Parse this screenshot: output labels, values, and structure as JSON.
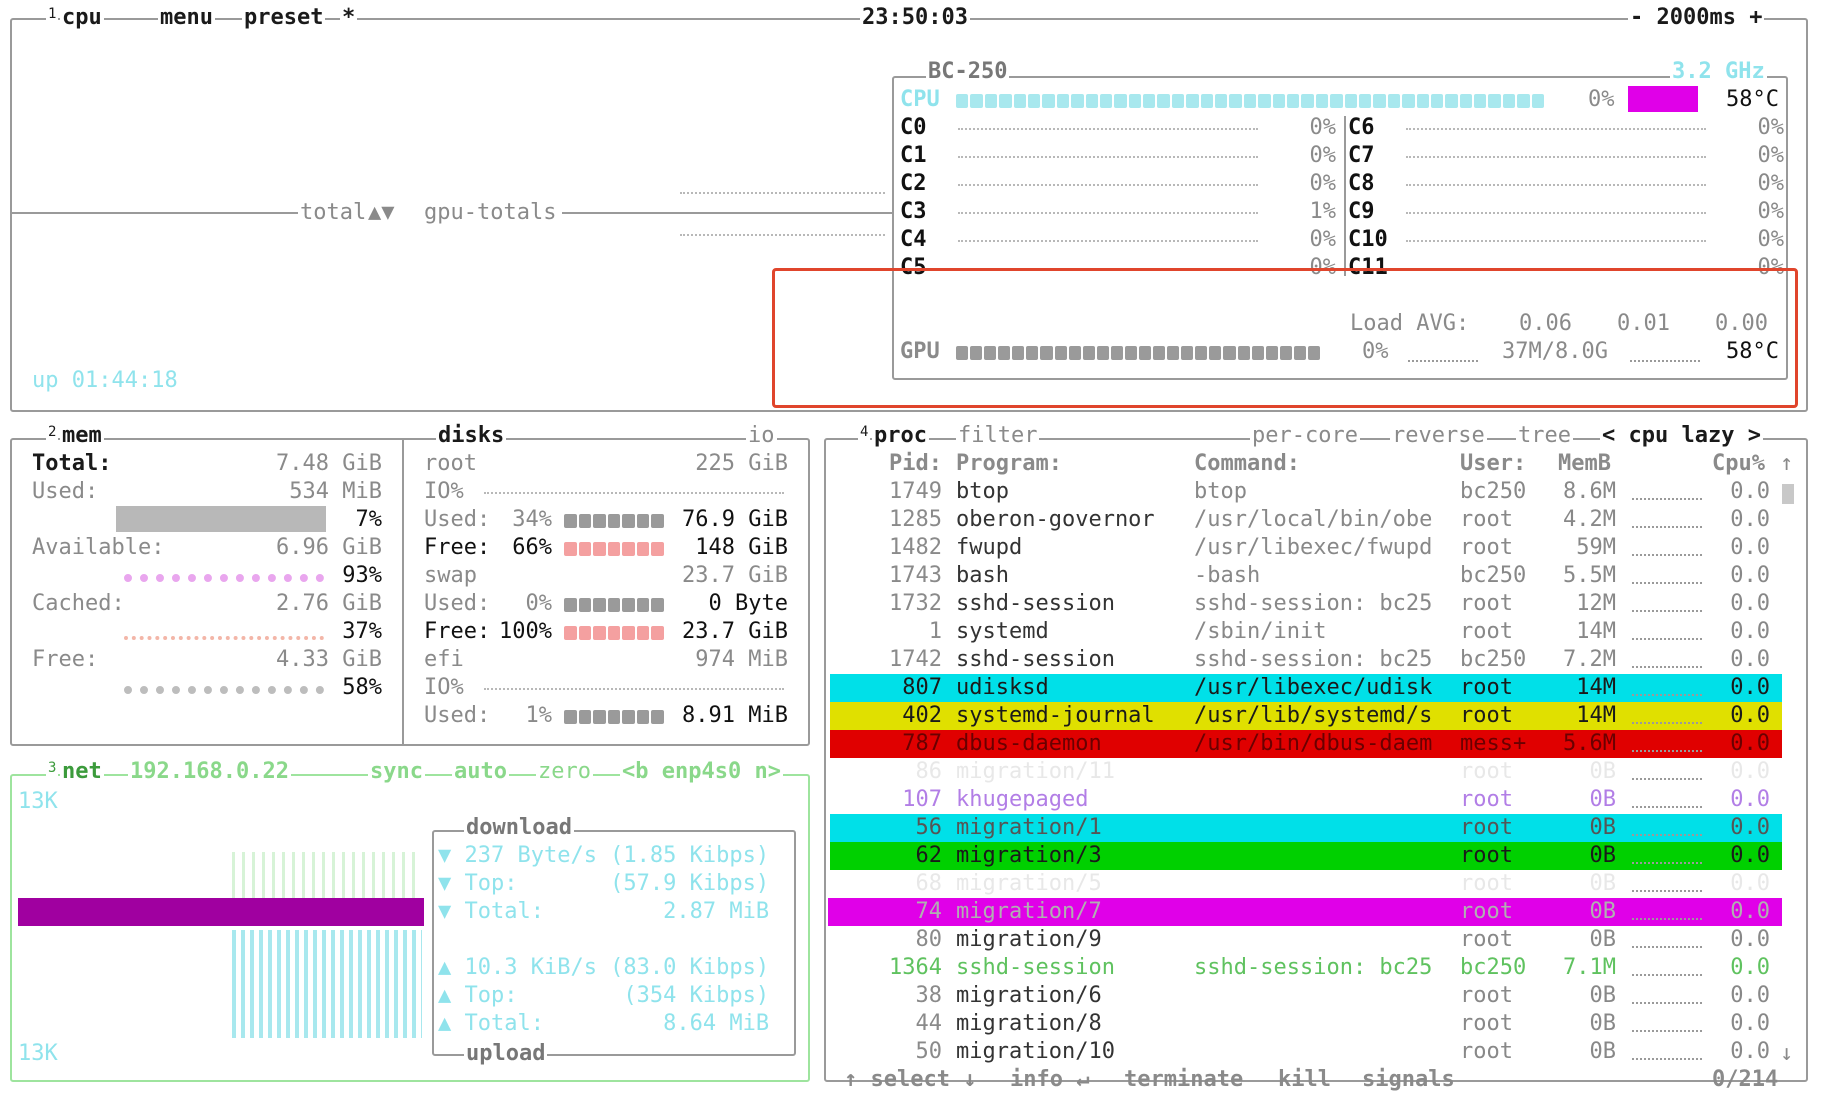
{
  "cpu_box": {
    "num": "1",
    "title": "cpu",
    "menu": "menu",
    "preset": "preset",
    "star": "*",
    "clock": "23:50:03",
    "interval": "- 2000ms +",
    "uptime": "up 01:44:18",
    "graph_label": "total",
    "graph_arrows": "▲▼",
    "graph_label2": "gpu-totals",
    "model": "BC-250",
    "freq": "3.2 GHz",
    "cpu_label": "CPU",
    "cpu_pct": "0%",
    "cpu_temp": "58°C",
    "cpu_pct_value": 0,
    "cores": [
      {
        "name": "C0",
        "pct": "0%"
      },
      {
        "name": "C1",
        "pct": "0%"
      },
      {
        "name": "C2",
        "pct": "0%"
      },
      {
        "name": "C3",
        "pct": "1%"
      },
      {
        "name": "C4",
        "pct": "0%"
      },
      {
        "name": "C5",
        "pct": "0%"
      },
      {
        "name": "C6",
        "pct": "0%"
      },
      {
        "name": "C7",
        "pct": "0%"
      },
      {
        "name": "C8",
        "pct": "0%"
      },
      {
        "name": "C9",
        "pct": "0%"
      },
      {
        "name": "C10",
        "pct": "0%"
      },
      {
        "name": "C11",
        "pct": "0%"
      }
    ],
    "load_label": "Load AVG:",
    "load": [
      "0.06",
      "0.01",
      "0.00"
    ],
    "gpu_label": "GPU",
    "gpu_pct": "0%",
    "gpu_mem": "37M/8.0G",
    "gpu_temp": "58°C"
  },
  "mem_box": {
    "num": "2",
    "title": "mem",
    "total_label": "Total:",
    "total_val": "7.48 GiB",
    "used_label": "Used:",
    "used_val": "534 MiB",
    "used_pct": "7%",
    "avail_label": "Available:",
    "avail_val": "6.96 GiB",
    "avail_pct": "93%",
    "cached_label": "Cached:",
    "cached_val": "2.76 GiB",
    "cached_pct": "37%",
    "free_label": "Free:",
    "free_val": "4.33 GiB",
    "free_pct": "58%"
  },
  "disks_box": {
    "title": "disks",
    "io": "io",
    "root_label": "root",
    "root_size": "225 GiB",
    "io_pct": "IO%",
    "root_used_label": "Used:",
    "root_used_pct": "34%",
    "root_used_val": "76.9 GiB",
    "root_free_label": "Free:",
    "root_free_pct": "66%",
    "root_free_val": "148 GiB",
    "swap_label": "swap",
    "swap_size": "23.7 GiB",
    "swap_used_label": "Used:",
    "swap_used_pct": "0%",
    "swap_used_val": "0 Byte",
    "swap_free_label": "Free:",
    "swap_free_pct": "100%",
    "swap_free_val": "23.7 GiB",
    "efi_label": "efi",
    "efi_size": "974 MiB",
    "efi_io": "IO%",
    "efi_used_label": "Used:",
    "efi_used_pct": "1%",
    "efi_used_val": "8.91 MiB"
  },
  "net_box": {
    "num": "3",
    "title": "net",
    "ip": "192.168.0.22",
    "sync": "sync",
    "auto": "auto",
    "zero": "zero",
    "iface": "<b enp4s0 n>",
    "scale_top": "13K",
    "scale_bottom": "13K",
    "download_title": "download",
    "dl_rate": "▼ 237 Byte/s (1.85 Kibps)",
    "dl_top": "▼ Top:       (57.9 Kibps)",
    "dl_total": "▼ Total:         2.87 MiB",
    "ul_rate": "▲ 10.3 KiB/s (83.0 Kibps)",
    "ul_top": "▲ Top:        (354 Kibps)",
    "ul_total": "▲ Total:         8.64 MiB",
    "upload_title": "upload"
  },
  "proc_box": {
    "num": "4",
    "title": "proc",
    "filter": "filter",
    "per_core": "per-core",
    "reverse": "reverse",
    "tree": "tree",
    "sort": "< cpu lazy >",
    "headers": {
      "pid": "Pid:",
      "program": "Program:",
      "command": "Command:",
      "user": "User:",
      "memb": "MemB",
      "cpu": "Cpu%"
    },
    "rows": [
      {
        "pid": "1749",
        "program": "btop",
        "command": "btop",
        "user": "bc250",
        "mem": "8.6M",
        "cpu": "0.0"
      },
      {
        "pid": "1285",
        "program": "oberon-governor",
        "command": "/usr/local/bin/obe",
        "user": "root",
        "mem": "4.2M",
        "cpu": "0.0"
      },
      {
        "pid": "1482",
        "program": "fwupd",
        "command": "/usr/libexec/fwupd",
        "user": "root",
        "mem": "59M",
        "cpu": "0.0"
      },
      {
        "pid": "1743",
        "program": "bash",
        "command": "-bash",
        "user": "bc250",
        "mem": "5.5M",
        "cpu": "0.0"
      },
      {
        "pid": "1732",
        "program": "sshd-session",
        "command": "sshd-session: bc25",
        "user": "root",
        "mem": "12M",
        "cpu": "0.0"
      },
      {
        "pid": "1",
        "program": "systemd",
        "command": "/sbin/init",
        "user": "root",
        "mem": "14M",
        "cpu": "0.0"
      },
      {
        "pid": "1742",
        "program": "sshd-session",
        "command": "sshd-session: bc25",
        "user": "bc250",
        "mem": "7.2M",
        "cpu": "0.0"
      },
      {
        "pid": "807",
        "program": "udisksd",
        "command": "/usr/libexec/udisk",
        "user": "root",
        "mem": "14M",
        "cpu": "0.0"
      },
      {
        "pid": "402",
        "program": "systemd-journal",
        "command": "/usr/lib/systemd/s",
        "user": "root",
        "mem": "14M",
        "cpu": "0.0"
      },
      {
        "pid": "787",
        "program": "dbus-daemon",
        "command": "/usr/bin/dbus-daem",
        "user": "mess+",
        "mem": "5.6M",
        "cpu": "0.0"
      },
      {
        "pid": "86",
        "program": "migration/11",
        "command": "",
        "user": "root",
        "mem": "0B",
        "cpu": "0.0"
      },
      {
        "pid": "107",
        "program": "khugepaged",
        "command": "",
        "user": "root",
        "mem": "0B",
        "cpu": "0.0"
      },
      {
        "pid": "56",
        "program": "migration/1",
        "command": "",
        "user": "root",
        "mem": "0B",
        "cpu": "0.0"
      },
      {
        "pid": "62",
        "program": "migration/3",
        "command": "",
        "user": "root",
        "mem": "0B",
        "cpu": "0.0"
      },
      {
        "pid": "68",
        "program": "migration/5",
        "command": "",
        "user": "root",
        "mem": "0B",
        "cpu": "0.0"
      },
      {
        "pid": "74",
        "program": "migration/7",
        "command": "",
        "user": "root",
        "mem": "0B",
        "cpu": "0.0"
      },
      {
        "pid": "80",
        "program": "migration/9",
        "command": "",
        "user": "root",
        "mem": "0B",
        "cpu": "0.0"
      },
      {
        "pid": "1364",
        "program": "sshd-session",
        "command": "sshd-session: bc25",
        "user": "bc250",
        "mem": "7.1M",
        "cpu": "0.0"
      },
      {
        "pid": "38",
        "program": "migration/6",
        "command": "",
        "user": "root",
        "mem": "0B",
        "cpu": "0.0"
      },
      {
        "pid": "44",
        "program": "migration/8",
        "command": "",
        "user": "root",
        "mem": "0B",
        "cpu": "0.0"
      },
      {
        "pid": "50",
        "program": "migration/10",
        "command": "",
        "user": "root",
        "mem": "0B",
        "cpu": "0.0"
      }
    ],
    "select": "↑ select ↓",
    "info": "info ↵",
    "terminate": "terminate",
    "kill": "kill",
    "signals": "signals",
    "count": "0/214"
  },
  "colors": {
    "cyan_highlight": "#00e0e8",
    "yellow_highlight": "#e0e000",
    "red_highlight": "#e00000",
    "green_highlight": "#00d000",
    "magenta_highlight": "#e000e8",
    "purple_graph": "#a000a0",
    "annotation_box": "#e0452c"
  }
}
